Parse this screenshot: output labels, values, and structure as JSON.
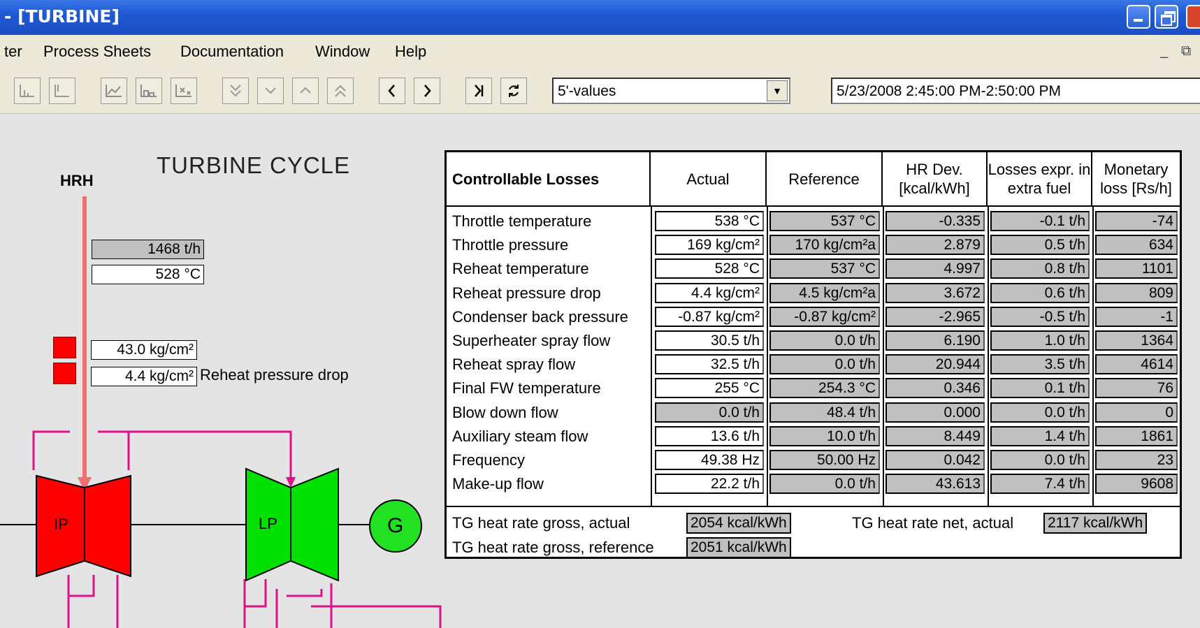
{
  "window": {
    "title": "- [TURBINE]"
  },
  "menu": {
    "items": [
      "ter",
      "Process Sheets",
      "Documentation",
      "Window",
      "Help"
    ],
    "mdi_minimize": "_",
    "mdi_restore": "⧉"
  },
  "toolbar": {
    "interval_value": "5'-values",
    "date_range": "5/23/2008 2:45:00 PM-2:50:00 PM",
    "icons": [
      "chart-icon",
      "chart2-icon",
      "trend-icon",
      "bar-icon",
      "scatter-icon",
      "double-down-icon",
      "down-icon",
      "up-icon",
      "double-up-icon",
      "prev-icon",
      "next-icon",
      "last-icon",
      "refresh-icon"
    ]
  },
  "diagram": {
    "title": "TURBINE CYCLE",
    "hrh_label": "HRH",
    "hrh_flow": "1468 t/h",
    "hrh_temp": "528 °C",
    "ip_pressure": "43.0 kg/cm²",
    "reheat_drop_value": "4.4 kg/cm²",
    "reheat_drop_label": "Reheat pressure drop",
    "ip_label": "IP",
    "lp_label": "LP",
    "generator_label": "G",
    "colors": {
      "ip": "#ff0000",
      "lp": "#00e000",
      "pipes": "#e0108a",
      "steam": "#f07070"
    }
  },
  "losses": {
    "headers": {
      "name": "Controllable Losses",
      "actual": "Actual",
      "reference": "Reference",
      "hr_dev": "HR Dev. [kcal/kWh]",
      "losses_fuel": "Losses expr. in extra fuel",
      "monetary": "Monetary loss [Rs/h]"
    },
    "rows": [
      {
        "name": "Throttle temperature",
        "actual": "538 °C",
        "reference": "537 °C",
        "hr_dev": "-0.335",
        "fuel": "-0.1 t/h",
        "money": "-74",
        "actual_gray": false
      },
      {
        "name": "Throttle pressure",
        "actual": "169 kg/cm²",
        "reference": "170 kg/cm²a",
        "hr_dev": "2.879",
        "fuel": "0.5 t/h",
        "money": "634",
        "actual_gray": false
      },
      {
        "name": "Reheat temperature",
        "actual": "528 °C",
        "reference": "537 °C",
        "hr_dev": "4.997",
        "fuel": "0.8 t/h",
        "money": "1101",
        "actual_gray": false
      },
      {
        "name": "Reheat pressure drop",
        "actual": "4.4 kg/cm²",
        "reference": "4.5 kg/cm²a",
        "hr_dev": "3.672",
        "fuel": "0.6 t/h",
        "money": "809",
        "actual_gray": false
      },
      {
        "name": "Condenser back pressure",
        "actual": "-0.87 kg/cm²",
        "reference": "-0.87 kg/cm²",
        "hr_dev": "-2.965",
        "fuel": "-0.5 t/h",
        "money": "-1",
        "actual_gray": false
      },
      {
        "name": "Superheater spray flow",
        "actual": "30.5 t/h",
        "reference": "0.0 t/h",
        "hr_dev": "6.190",
        "fuel": "1.0 t/h",
        "money": "1364",
        "actual_gray": false
      },
      {
        "name": "Reheat spray flow",
        "actual": "32.5 t/h",
        "reference": "0.0 t/h",
        "hr_dev": "20.944",
        "fuel": "3.5 t/h",
        "money": "4614",
        "actual_gray": false
      },
      {
        "name": "Final FW temperature",
        "actual": "255 °C",
        "reference": "254.3 °C",
        "hr_dev": "0.346",
        "fuel": "0.1 t/h",
        "money": "76",
        "actual_gray": false
      },
      {
        "name": "Blow down flow",
        "actual": "0.0 t/h",
        "reference": "48.4 t/h",
        "hr_dev": "0.000",
        "fuel": "0.0 t/h",
        "money": "0",
        "actual_gray": true
      },
      {
        "name": "Auxiliary steam flow",
        "actual": "13.6 t/h",
        "reference": "10.0 t/h",
        "hr_dev": "8.449",
        "fuel": "1.4 t/h",
        "money": "1861",
        "actual_gray": false
      },
      {
        "name": "Frequency",
        "actual": "49.38 Hz",
        "reference": "50.00 Hz",
        "hr_dev": "0.042",
        "fuel": "0.0 t/h",
        "money": "23",
        "actual_gray": false
      },
      {
        "name": "Make-up flow",
        "actual": "22.2 t/h",
        "reference": "0.0 t/h",
        "hr_dev": "43.613",
        "fuel": "7.4 t/h",
        "money": "9608",
        "actual_gray": false
      }
    ],
    "footer": {
      "gross_actual_label": "TG heat rate gross, actual",
      "gross_actual_value": "2054 kcal/kWh",
      "gross_ref_label": "TG heat rate gross, reference",
      "gross_ref_value": "2051 kcal/kWh",
      "net_actual_label": "TG heat rate net, actual",
      "net_actual_value": "2117 kcal/kWh"
    }
  }
}
